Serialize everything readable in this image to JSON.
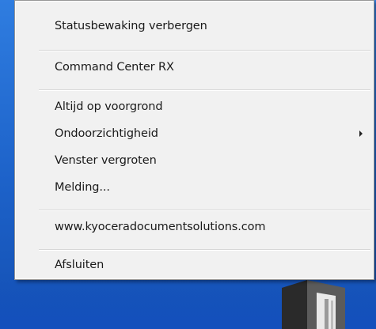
{
  "context_menu": {
    "items": [
      {
        "label": "Statusbewaking verbergen"
      },
      {
        "label": "Command Center RX"
      },
      {
        "label": "Altijd op voorgrond"
      },
      {
        "label": "Ondoorzichtigheid",
        "has_submenu": true
      },
      {
        "label": "Venster vergroten"
      },
      {
        "label": "Melding..."
      },
      {
        "label": "www.kyoceradocumentsolutions.com"
      },
      {
        "label": "Afsluiten"
      }
    ]
  },
  "colors": {
    "desktop_blue": "#1d62c9",
    "menu_background": "#f1f1f1",
    "separator": "#d7d7d7"
  },
  "icons": {
    "submenu": "chevron-right-icon",
    "tray_device": "printer-icon"
  }
}
